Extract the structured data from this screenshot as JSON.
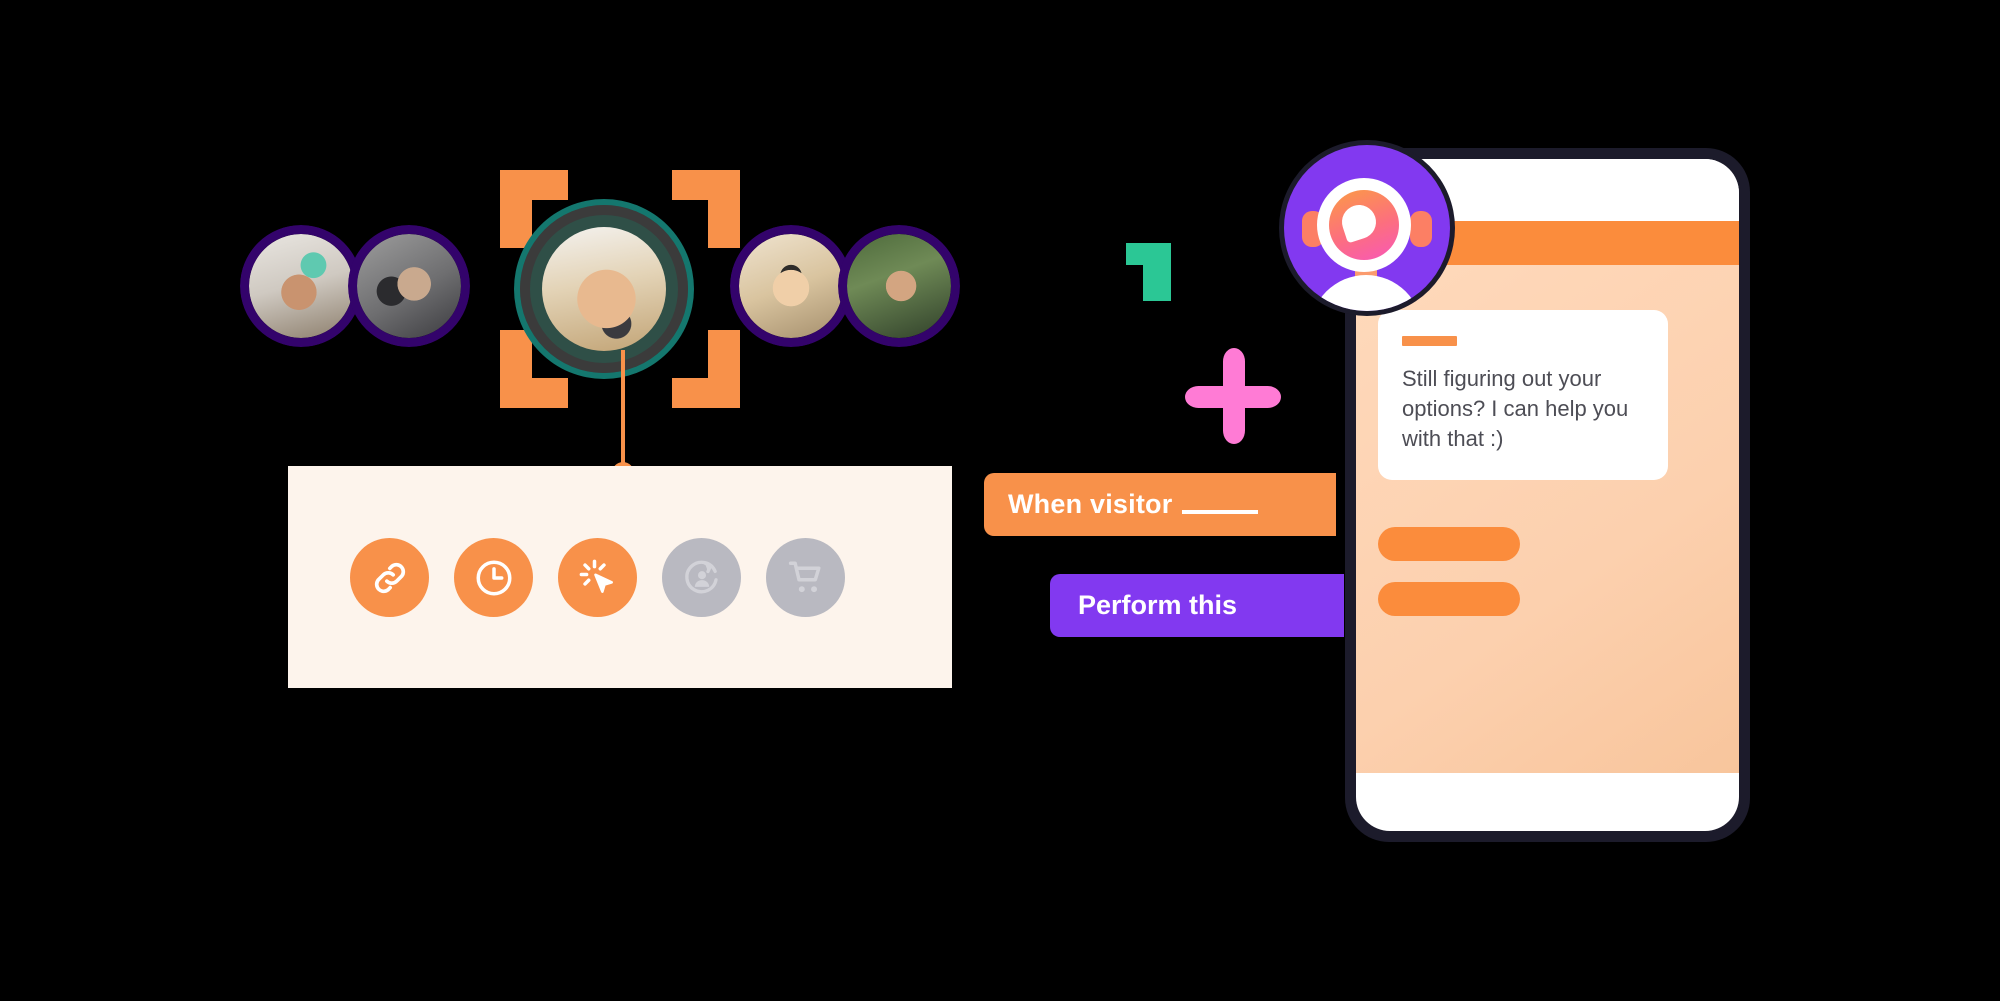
{
  "scene": {
    "title": "Visitor trigger and chatbot automation illustration"
  },
  "avatars": {
    "label_left_1": "visitor-avatar-1",
    "label_left_2": "visitor-avatar-2",
    "label_center": "focused-visitor-avatar",
    "label_right_1": "visitor-avatar-4",
    "label_right_2": "visitor-avatar-5"
  },
  "trigger_panel": {
    "background_color": "#fdf4ec",
    "icons": [
      {
        "name": "link-icon",
        "state": "active",
        "color": "#f8914a"
      },
      {
        "name": "clock-icon",
        "state": "active",
        "color": "#f8914a"
      },
      {
        "name": "click-cursor-icon",
        "state": "active",
        "color": "#f8914a"
      },
      {
        "name": "returning-visitor-icon",
        "state": "inactive",
        "color": "#b9b9c1"
      },
      {
        "name": "shopping-cart-icon",
        "state": "inactive",
        "color": "#b9b9c1"
      }
    ]
  },
  "labels": {
    "when_visitor": "When visitor",
    "when_visitor_blank": "____",
    "perform_this": "Perform this",
    "when_color": "#f8914a",
    "perform_color": "#8239f0"
  },
  "decorations": {
    "green_shape": "green-accent-shape",
    "pink_star": "pink-sparkle-shape",
    "green_color": "#2bc795",
    "pink_color": "#ff7bd5"
  },
  "phone": {
    "frame_color": "#1c1b2b",
    "header_color": "#fb8c3c",
    "body_color": "#fcd0ae",
    "chat": {
      "message": "Still figuring out your options? I can help you with that :)",
      "accent_dash_color": "#f8914a",
      "quick_replies": [
        {
          "name": "quick-reply-1"
        },
        {
          "name": "quick-reply-2"
        }
      ]
    },
    "bot": {
      "name": "chatbot-avatar",
      "badge_color": "#8239f0"
    }
  }
}
